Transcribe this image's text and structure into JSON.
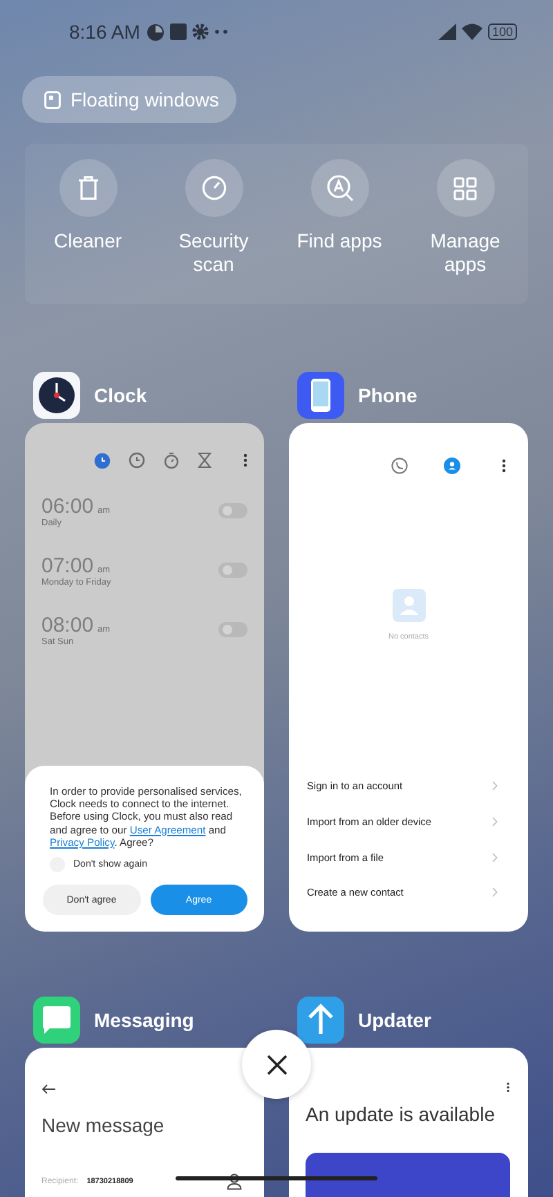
{
  "status_bar": {
    "time": "8:16 AM",
    "battery": "100"
  },
  "floating_windows": {
    "label": "Floating windows"
  },
  "quick_actions": [
    {
      "kind": "cleaner",
      "label": "Cleaner"
    },
    {
      "kind": "security",
      "label": "Security scan"
    },
    {
      "kind": "find",
      "label": "Find apps"
    },
    {
      "kind": "manage",
      "label": "Manage apps"
    }
  ],
  "clock": {
    "name": "Clock",
    "tabs": [
      {
        "kind": "alarm",
        "selected": true
      },
      {
        "kind": "clock",
        "selected": false
      },
      {
        "kind": "stopwatch",
        "selected": false
      },
      {
        "kind": "timer",
        "selected": false
      }
    ],
    "alarms": [
      {
        "time": "06:00",
        "suffix": "am",
        "repeat": "Daily",
        "on": false
      },
      {
        "time": "07:00",
        "suffix": "am",
        "repeat": "Monday to Friday",
        "on": false
      },
      {
        "time": "08:00",
        "suffix": "am",
        "repeat": "Sat Sun",
        "on": false
      }
    ],
    "dialog": {
      "text_before": "In order to provide personalised services, Clock needs to connect to the internet. Before using Clock, you must also read and agree to our",
      "link_1": "User Agreement",
      "text_middle": "and",
      "link_2": "Privacy Policy",
      "text_after": ". Agree?",
      "checkbox_label": "Don't show again",
      "checked": false,
      "decline": "Don't agree",
      "accept": "Agree"
    }
  },
  "phone": {
    "name": "Phone",
    "tabs": [
      {
        "kind": "calls",
        "selected": false
      },
      {
        "kind": "contacts",
        "selected": true
      }
    ],
    "empty_text": "No contacts",
    "options": [
      "Sign in to an account",
      "Import from an older device",
      "Import from a file",
      "Create a new contact"
    ]
  },
  "messaging": {
    "name": "Messaging",
    "title": "New message",
    "recipient_label": "Recipient:",
    "recipient": "18730218809"
  },
  "updater": {
    "name": "Updater",
    "title": "An update is available"
  }
}
